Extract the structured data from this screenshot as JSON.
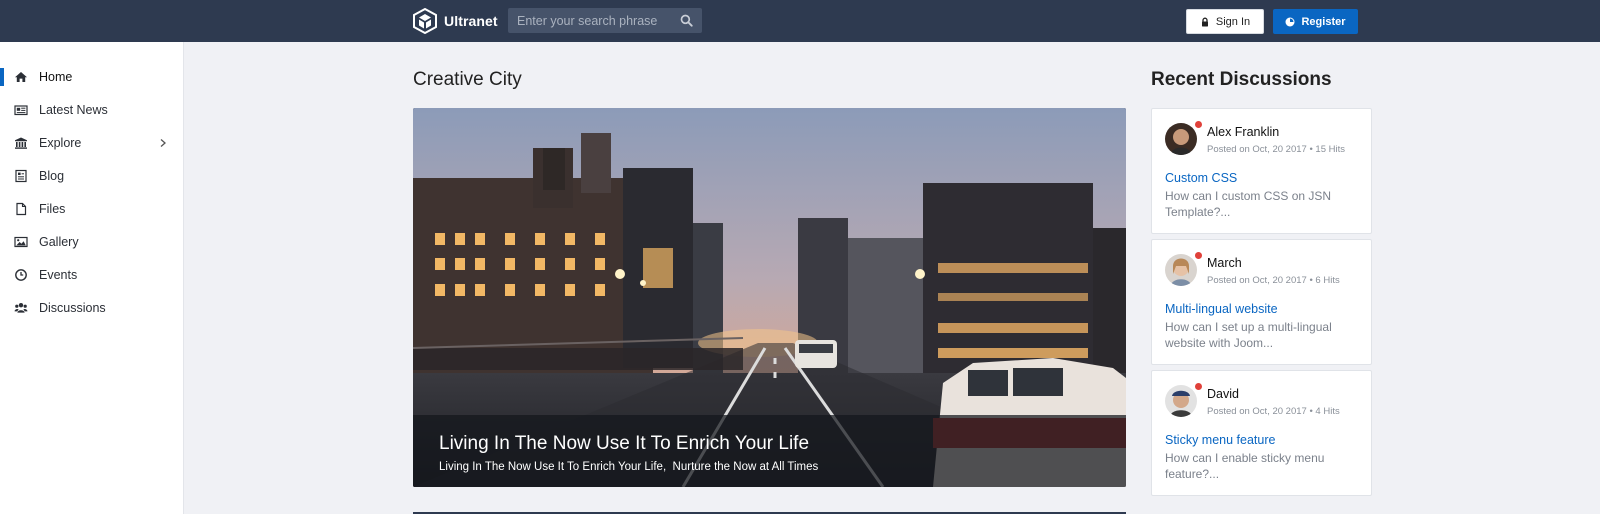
{
  "header": {
    "brand_name": "Ultranet",
    "search_placeholder": "Enter your search phrase",
    "signin_label": "Sign In",
    "register_label": "Register",
    "colors": {
      "bar": "#2e3a50",
      "accent": "#0a66c2"
    }
  },
  "sidebar": {
    "items": [
      {
        "label": "Home",
        "icon": "home-icon",
        "active": true
      },
      {
        "label": "Latest News",
        "icon": "newspaper-icon"
      },
      {
        "label": "Explore",
        "icon": "bank-icon",
        "has_submenu": true
      },
      {
        "label": "Blog",
        "icon": "blog-icon"
      },
      {
        "label": "Files",
        "icon": "file-icon"
      },
      {
        "label": "Gallery",
        "icon": "image-icon"
      },
      {
        "label": "Events",
        "icon": "clock-icon"
      },
      {
        "label": "Discussions",
        "icon": "users-icon"
      }
    ]
  },
  "main": {
    "section_title": "Creative City",
    "hero": {
      "title": "Living In The Now Use It To Enrich Your Life",
      "subtitle": "Living In The Now Use It To Enrich Your Life,  Nurture the Now at All Times"
    }
  },
  "recent": {
    "title": "Recent Discussions",
    "items": [
      {
        "author": "Alex Franklin",
        "meta": "Posted on Oct, 20 2017 • 15 Hits",
        "topic": "Custom CSS",
        "excerpt": "How can I custom CSS on JSN Template?..."
      },
      {
        "author": "March",
        "meta": "Posted on Oct, 20 2017 • 6 Hits",
        "topic": "Multi-lingual website",
        "excerpt": "How can I set up a multi-lingual website with Joom..."
      },
      {
        "author": "David",
        "meta": "Posted on Oct, 20 2017 • 4 Hits",
        "topic": "Sticky menu feature",
        "excerpt": "How can I enable sticky menu feature?..."
      }
    ]
  }
}
